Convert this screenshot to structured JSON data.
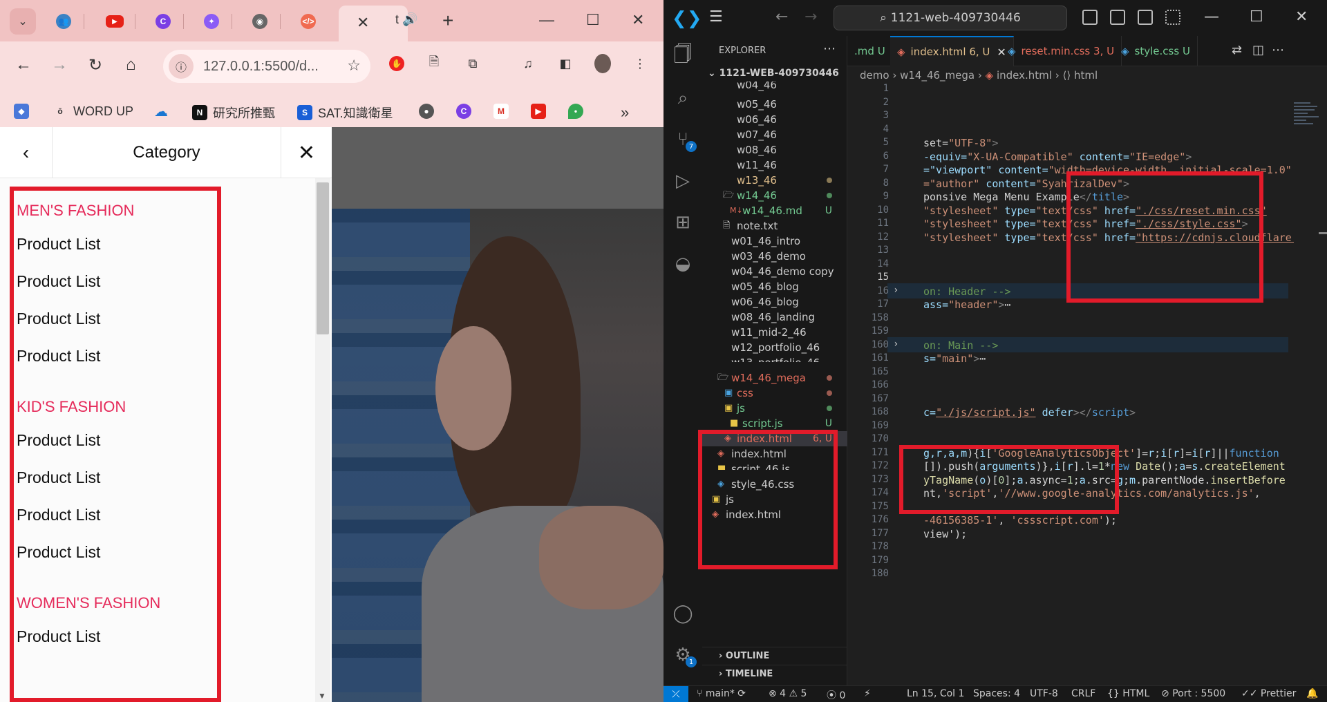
{
  "browser": {
    "address": "127.0.0.1:5500/d...",
    "tab_active_title": "t",
    "bookmarks": {
      "items": [
        {
          "label": "WORD UP"
        },
        {
          "label": "研究所推甄"
        },
        {
          "label": "SAT.知識衛星"
        }
      ],
      "more": "»"
    }
  },
  "page": {
    "category_title": "Category",
    "groups": [
      {
        "title": "MEN'S FASHION",
        "items": [
          "Product List",
          "Product List",
          "Product List",
          "Product List"
        ]
      },
      {
        "title": "KID'S FASHION",
        "items": [
          "Product List",
          "Product List",
          "Product List",
          "Product List"
        ]
      },
      {
        "title": "WOMEN'S FASHION",
        "items": [
          "Product List"
        ]
      }
    ]
  },
  "vscode": {
    "search": "1121-web-409730446",
    "explorer_title": "EXPLORER",
    "root": "1121-WEB-409730446",
    "tree": [
      {
        "name": "w04_46",
        "y": 0
      },
      {
        "name": "w05_46"
      },
      {
        "name": "w06_46"
      },
      {
        "name": "w07_46"
      },
      {
        "name": "w08_46"
      },
      {
        "name": "w11_46"
      },
      {
        "name": "w13_46"
      },
      {
        "name": "w14_46"
      },
      {
        "name": "w14_46.md",
        "badge": "U"
      },
      {
        "name": "note.txt"
      },
      {
        "name": "w01_46_intro"
      },
      {
        "name": "w03_46_demo"
      },
      {
        "name": "w04_46_demo copy"
      },
      {
        "name": "w05_46_blog"
      },
      {
        "name": "w06_46_blog"
      },
      {
        "name": "w08_46_landing"
      },
      {
        "name": "w11_mid-2_46"
      },
      {
        "name": "w12_portfolio_46"
      },
      {
        "name": "w13_portfolio_46"
      },
      {
        "name": "w14_46_mega"
      },
      {
        "name": "css"
      },
      {
        "name": "js"
      },
      {
        "name": "script.js",
        "badge": "U"
      },
      {
        "name": "index.html",
        "badge": "6, U"
      },
      {
        "name": "index.html"
      },
      {
        "name": "script_46.js"
      },
      {
        "name": "style_46.css"
      },
      {
        "name": "js"
      },
      {
        "name": "index.html"
      }
    ],
    "outline": "OUTLINE",
    "timeline": "TIMELINE",
    "tabs": [
      {
        "label": ".md",
        "badge": "U"
      },
      {
        "label": "index.html",
        "badge": "6, U"
      },
      {
        "label": "reset.min.css",
        "badge": "3, U"
      },
      {
        "label": "style.css",
        "badge": "U"
      }
    ],
    "breadcrumbs": [
      "demo",
      "w14_46_mega",
      "index.html",
      "html"
    ],
    "line_numbers": [
      "1",
      "2",
      "3",
      "4",
      "5",
      "6",
      "7",
      "8",
      "9",
      "10",
      "11",
      "12",
      "13",
      "14",
      "15",
      "16",
      "17",
      "158",
      "159",
      "160",
      "161",
      "165",
      "166",
      "167",
      "168",
      "169",
      "170",
      "171",
      "172",
      "173",
      "174",
      "175",
      "176",
      "177",
      "178",
      "179",
      "180"
    ],
    "code": [
      {
        "ln": "5",
        "parts": [
          [
            "def",
            "set="
          ],
          [
            "str",
            "\"UTF-8\""
          ],
          [
            "tag",
            ">"
          ]
        ]
      },
      {
        "ln": "6",
        "parts": [
          [
            "attr",
            "-equiv="
          ],
          [
            "str",
            "\"X-UA-Compatible\""
          ],
          [
            "def",
            " "
          ],
          [
            "attr",
            "content="
          ],
          [
            "str",
            "\"IE=edge\""
          ],
          [
            "tag",
            ">"
          ]
        ]
      },
      {
        "ln": "7",
        "parts": [
          [
            "attr",
            "=\"viewport\""
          ],
          [
            "def",
            " "
          ],
          [
            "attr",
            "content="
          ],
          [
            "str",
            "\"width=device-width, initial-scale=1.0\""
          ]
        ]
      },
      {
        "ln": "8",
        "parts": [
          [
            "str",
            "=\"author\""
          ],
          [
            "def",
            " "
          ],
          [
            "attr",
            "content="
          ],
          [
            "str",
            "\"SyahrizalDev\""
          ],
          [
            "tag",
            ">"
          ]
        ]
      },
      {
        "ln": "9",
        "parts": [
          [
            "def",
            "ponsive Mega Menu Example"
          ],
          [
            "tag",
            "</"
          ],
          [
            "tg2",
            "title"
          ],
          [
            "tag",
            ">"
          ]
        ]
      },
      {
        "ln": "10",
        "parts": [
          [
            "str",
            "\"stylesheet\""
          ],
          [
            "def",
            " "
          ],
          [
            "attr",
            "type="
          ],
          [
            "str",
            "\"text/css\""
          ],
          [
            "def",
            " "
          ],
          [
            "attr",
            "href="
          ],
          [
            "str",
            "\"./css/reset.min.css\""
          ]
        ]
      },
      {
        "ln": "11",
        "parts": [
          [
            "str",
            "\"stylesheet\""
          ],
          [
            "def",
            " "
          ],
          [
            "attr",
            "type="
          ],
          [
            "str",
            "\"text/css\""
          ],
          [
            "def",
            " "
          ],
          [
            "attr",
            "href="
          ],
          [
            "str",
            "\"./css/style.css\""
          ],
          [
            "tag",
            ">"
          ]
        ]
      },
      {
        "ln": "12",
        "parts": [
          [
            "str",
            "\"stylesheet\""
          ],
          [
            "def",
            " "
          ],
          [
            "attr",
            "type="
          ],
          [
            "str",
            "\"text/css\""
          ],
          [
            "def",
            " "
          ],
          [
            "attr",
            "href="
          ],
          [
            "str",
            "\"https://cdnjs.cloudflare.com/"
          ]
        ]
      },
      {
        "ln": "16",
        "parts": [
          [
            "cmt",
            "on: Header -->"
          ]
        ]
      },
      {
        "ln": "17",
        "parts": [
          [
            "attr",
            "ass="
          ],
          [
            "str",
            "\"header\""
          ],
          [
            "tag",
            ">"
          ],
          [
            "def",
            "⋯"
          ]
        ]
      },
      {
        "ln": "160",
        "parts": [
          [
            "cmt",
            "on: Main -->"
          ]
        ]
      },
      {
        "ln": "161",
        "parts": [
          [
            "attr",
            "s="
          ],
          [
            "str",
            "\"main\""
          ],
          [
            "tag",
            ">"
          ],
          [
            "def",
            "⋯"
          ]
        ]
      },
      {
        "ln": "168",
        "parts": [
          [
            "attr",
            "c="
          ],
          [
            "str",
            "\"./js/script.js\""
          ],
          [
            "def",
            " "
          ],
          [
            "attr",
            "defer"
          ],
          [
            "tag",
            "></"
          ],
          [
            "tg2",
            "script"
          ],
          [
            "tag",
            ">"
          ]
        ]
      },
      {
        "ln": "171",
        "parts": [
          [
            "var",
            "g,r,a,m"
          ],
          [
            "def",
            "){"
          ],
          [
            "var",
            "i"
          ],
          [
            "def",
            "["
          ],
          [
            "str",
            "'GoogleAnalyticsObject'"
          ],
          [
            "def",
            "]="
          ],
          [
            "var",
            "r"
          ],
          [
            "def",
            ";"
          ],
          [
            "var",
            "i"
          ],
          [
            "def",
            "["
          ],
          [
            "var",
            "r"
          ],
          [
            "def",
            "]="
          ],
          [
            "var",
            "i"
          ],
          [
            "def",
            "["
          ],
          [
            "var",
            "r"
          ],
          [
            "def",
            "]||"
          ],
          [
            "kw",
            "function"
          ]
        ]
      },
      {
        "ln": "172",
        "parts": [
          [
            "def",
            "[]).push("
          ],
          [
            "var",
            "arguments"
          ],
          [
            "def",
            ")},"
          ],
          [
            "var",
            "i"
          ],
          [
            "def",
            "["
          ],
          [
            "var",
            "r"
          ],
          [
            "def",
            "].l="
          ],
          [
            "num",
            "1"
          ],
          [
            "def",
            "*"
          ],
          [
            "kw",
            "new"
          ],
          [
            "def",
            " "
          ],
          [
            "fn",
            "Date"
          ],
          [
            "def",
            "();"
          ],
          [
            "var",
            "a"
          ],
          [
            "def",
            "="
          ],
          [
            "var",
            "s"
          ],
          [
            "def",
            "."
          ],
          [
            "fn",
            "createElement"
          ]
        ]
      },
      {
        "ln": "173",
        "parts": [
          [
            "fn",
            "yTagName"
          ],
          [
            "def",
            "("
          ],
          [
            "var",
            "o"
          ],
          [
            "def",
            ")["
          ],
          [
            "num",
            "0"
          ],
          [
            "def",
            "];"
          ],
          [
            "var",
            "a"
          ],
          [
            "def",
            ".async="
          ],
          [
            "num",
            "1"
          ],
          [
            "def",
            ";"
          ],
          [
            "var",
            "a"
          ],
          [
            "def",
            ".src="
          ],
          [
            "var",
            "g"
          ],
          [
            "def",
            ";"
          ],
          [
            "var",
            "m"
          ],
          [
            "def",
            ".parentNode."
          ],
          [
            "fn",
            "insertBefore"
          ]
        ]
      },
      {
        "ln": "174",
        "parts": [
          [
            "def",
            "nt,"
          ],
          [
            "str",
            "'script'"
          ],
          [
            "def",
            ","
          ],
          [
            "str",
            "'//www.google-analytics.com/analytics.js'"
          ],
          [
            "def",
            ","
          ]
        ]
      },
      {
        "ln": "176",
        "parts": [
          [
            "str",
            "-46156385-1'"
          ],
          [
            "def",
            ", "
          ],
          [
            "str",
            "'cssscript.com'"
          ],
          [
            "def",
            ");"
          ]
        ]
      },
      {
        "ln": "177",
        "parts": [
          [
            "def",
            "view'"
          ],
          [
            "def",
            ");"
          ]
        ]
      }
    ],
    "status": {
      "branch": "main*",
      "errors": "⊗ 4 ⚠ 5",
      "ports0": "⦿ 0",
      "pos": "Ln 15, Col 1",
      "spaces": "Spaces: 4",
      "enc": "UTF-8",
      "eol": "CRLF",
      "lang": "HTML",
      "port": "Port : 5500",
      "prettier": "Prettier"
    },
    "colors": {
      "accent": "#0078d4",
      "modified": "#e2c08d",
      "untracked": "#73c991"
    }
  }
}
